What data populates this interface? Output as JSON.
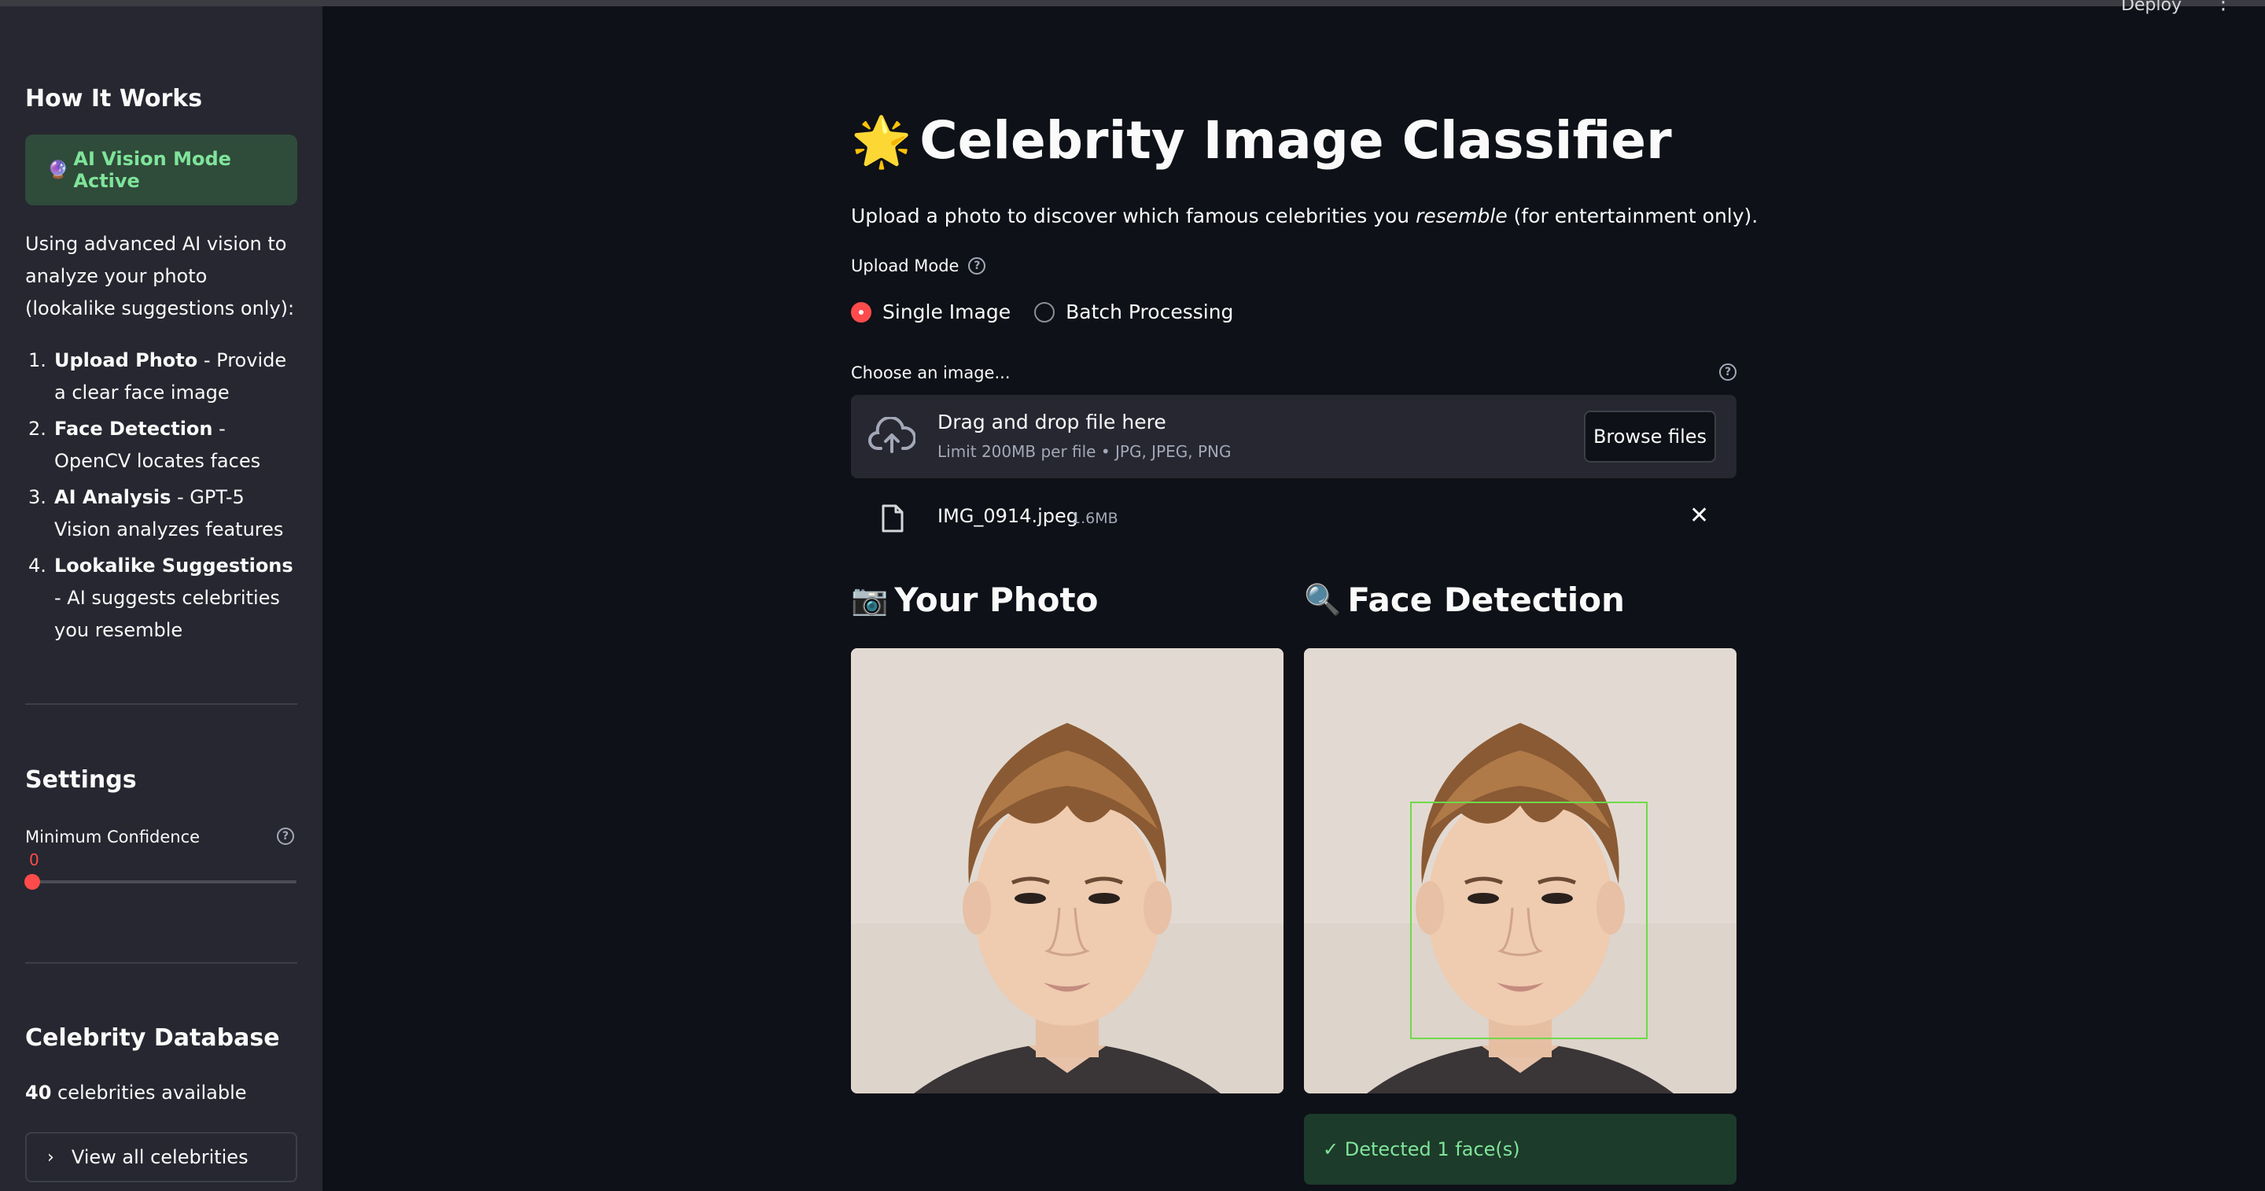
{
  "topbar": {
    "deploy": "Deploy",
    "menu": "⋮"
  },
  "sidebar": {
    "how_title": "How It Works",
    "ai_badge": "AI Vision Mode Active",
    "intro": "Using advanced AI vision to analyze your photo (lookalike suggestions only):",
    "steps": [
      {
        "n": "1.",
        "bold": "Upload Photo",
        "rest": " - Provide a clear face image"
      },
      {
        "n": "2.",
        "bold": "Face Detection",
        "rest": " - OpenCV locates faces"
      },
      {
        "n": "3.",
        "bold": "AI Analysis",
        "rest": " - GPT-5 Vision analyzes features"
      },
      {
        "n": "4.",
        "bold": "Lookalike Suggestions",
        "rest": " - AI suggests celebrities you resemble"
      }
    ],
    "settings_title": "Settings",
    "confidence_label": "Minimum Confidence",
    "confidence_value": "0",
    "confidence_fraction": 0,
    "db_title": "Celebrity Database",
    "db_count": "40",
    "db_count_suffix": " celebrities available",
    "view_all": "View all celebrities"
  },
  "main": {
    "title": "Celebrity Image Classifier",
    "subtitle_pre": "Upload a photo to discover which famous celebrities you ",
    "subtitle_em": "resemble",
    "subtitle_post": " (for entertainment only).",
    "upload_mode_label": "Upload Mode",
    "modes": [
      "Single Image",
      "Batch Processing"
    ],
    "selected_mode": "Single Image",
    "choose_label": "Choose an image...",
    "drop_title": "Drag and drop file here",
    "drop_limit": "Limit 200MB per file • JPG, JPEG, PNG",
    "browse_label": "Browse files",
    "file_name": "IMG_0914.jpeg",
    "file_size": "1.6MB",
    "your_photo_title": "Your Photo",
    "face_detection_title": "Face Detection",
    "detected_msg": "✓ Detected 1 face(s)"
  },
  "colors": {
    "accent": "#ff4b4b",
    "success_text": "#7fe49a",
    "face_box": "#6fd94a"
  }
}
